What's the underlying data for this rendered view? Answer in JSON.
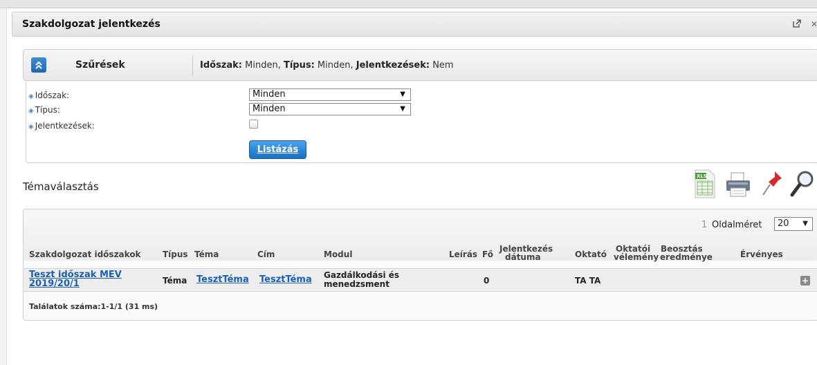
{
  "panel": {
    "title": "Szakdolgozat jelentkezés"
  },
  "filter": {
    "label": "Szűrések",
    "summary": [
      {
        "key": "Időszak:",
        "value": " Minden, "
      },
      {
        "key": "Típus:",
        "value": " Minden, "
      },
      {
        "key": "Jelentkezések:",
        "value": " Nem"
      }
    ],
    "fields": {
      "period_label": "Időszak:",
      "type_label": "Típus:",
      "applications_label": "Jelentkezések:",
      "period_value": "Minden",
      "type_value": "Minden",
      "applications_checked": false
    },
    "list_button": "Listázás"
  },
  "section": {
    "title": "Témaválasztás"
  },
  "toolbar": {
    "xls_text": "XLS",
    "icons": [
      "xls-export-icon",
      "print-icon",
      "pin-icon",
      "zoom-icon"
    ]
  },
  "grid": {
    "page_number": "1",
    "page_size_label": "Oldalméret",
    "page_size_value": "20",
    "columns": {
      "period": "Szakdolgozat időszakok",
      "type": "Típus",
      "topic": "Téma",
      "title": "Cím",
      "module": "Modul",
      "description": "Leírás",
      "headcount": "Fő",
      "app_date_1": "Jelentkezés",
      "app_date_2": "dátuma",
      "teacher": "Oktató",
      "teacher_opinion_1": "Oktatói",
      "teacher_opinion_2": "vélemény",
      "assignment_result_1": "Beosztás",
      "assignment_result_2": "eredménye",
      "valid": "Érvényes"
    },
    "rows": [
      {
        "period_1": "Teszt időszak MEV",
        "period_2": "2019/20/1",
        "type": "Téma",
        "topic": "TesztTéma",
        "title": "TesztTéma",
        "module_1": "Gazdálkodási és",
        "module_2": "menedzsment",
        "headcount": "0",
        "teacher": "TA TA"
      }
    ],
    "footer": "Találatok száma:1-1/1 (31 ms)"
  },
  "colors": {
    "accent": "#1d6fc2",
    "link": "#1a5fb4"
  }
}
